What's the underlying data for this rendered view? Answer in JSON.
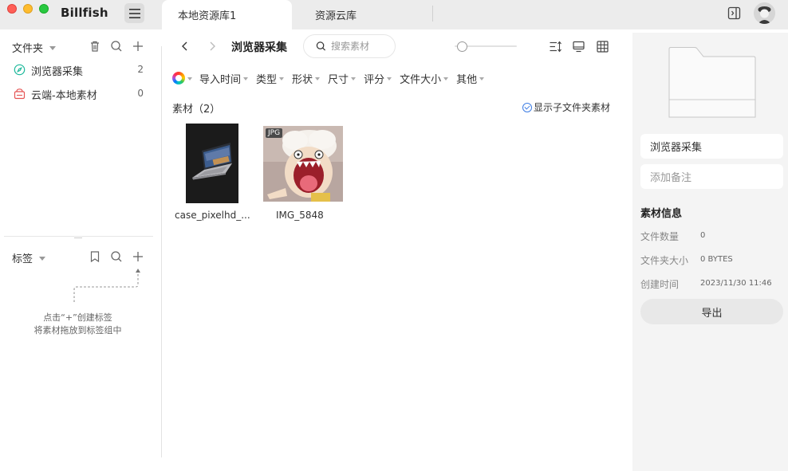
{
  "app": {
    "title": "Billfish"
  },
  "tabs": [
    {
      "label": "本地资源库1",
      "active": true
    },
    {
      "label": "资源云库",
      "active": false
    }
  ],
  "sidebar": {
    "folders_header": "文件夹",
    "folders": [
      {
        "label": "浏览器采集",
        "count": "2",
        "icon": "compass-icon"
      },
      {
        "label": "云端-本地素材",
        "count": "0",
        "icon": "cloud-drive-icon"
      }
    ],
    "tags_header": "标签",
    "tags_hint_line1": "点击“+”创建标签",
    "tags_hint_line2": "将素材拖放到标签组中"
  },
  "main": {
    "breadcrumb": "浏览器采集",
    "search_placeholder": "搜索素材",
    "zoom_level": 0.05,
    "filters": [
      "导入时间",
      "类型",
      "形状",
      "尺寸",
      "评分",
      "文件大小",
      "其他"
    ],
    "section_title": "素材（2）",
    "show_subfolder": "显示子文件夹素材",
    "items": [
      {
        "name": "case_pixelhd_...",
        "badge": ""
      },
      {
        "name": "IMG_5848",
        "badge": "JPG"
      }
    ]
  },
  "inspector": {
    "folder_name": "浏览器采集",
    "note_placeholder": "添加备注",
    "info_title": "素材信息",
    "file_count_label": "文件数量",
    "file_count_value": "0",
    "folder_size_label": "文件夹大小",
    "folder_size_value": "0 BYTES",
    "created_label": "创建时间",
    "created_value": "2023/11/30 11:46",
    "export_label": "导出"
  },
  "colors": {
    "accent_blue": "#3d7de4",
    "browser_folder_icon": "#1bb89a",
    "cloud_folder_icon": "#e55353",
    "titlebar": "#ececec",
    "inspector_bg": "#f4f4f4"
  }
}
